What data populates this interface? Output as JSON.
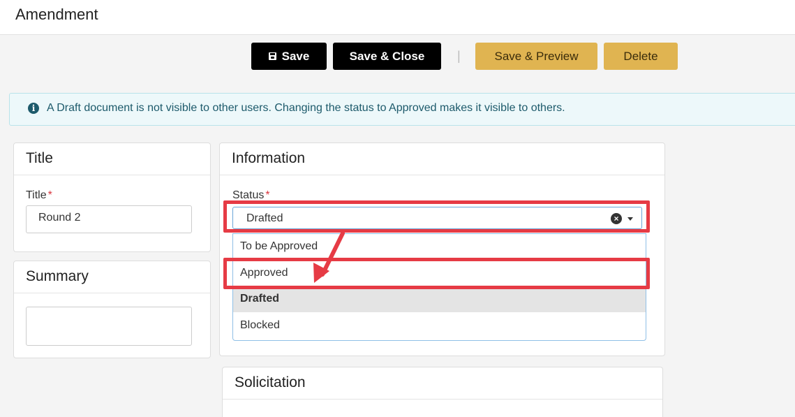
{
  "header": {
    "title": "Amendment"
  },
  "toolbar": {
    "save_label": "Save",
    "save_close_label": "Save & Close",
    "separator": "|",
    "save_preview_label": "Save & Preview",
    "delete_label": "Delete"
  },
  "info_banner": {
    "icon": "info-icon",
    "icon_glyph": "i",
    "text": "A Draft document is not visible to other users. Changing the status to Approved makes it visible to others."
  },
  "title_panel": {
    "heading": "Title",
    "field_label": "Title",
    "required_mark": "*",
    "value": "Round 2"
  },
  "summary_panel": {
    "heading": "Summary",
    "value": ""
  },
  "information_panel": {
    "heading": "Information",
    "status_label": "Status",
    "required_mark": "*",
    "status_value": "Drafted",
    "clear_glyph": "×",
    "options": [
      "To be Approved",
      "Approved",
      "Drafted",
      "Blocked"
    ],
    "selected_option": "Drafted"
  },
  "solicitation_panel": {
    "heading": "Solicitation"
  },
  "annotation": {
    "highlight_color": "#e63b45"
  },
  "colors": {
    "primary_button": "#000000",
    "secondary_button": "#e0b451",
    "banner_bg": "#edf8fa",
    "banner_text": "#1d5a6b"
  }
}
